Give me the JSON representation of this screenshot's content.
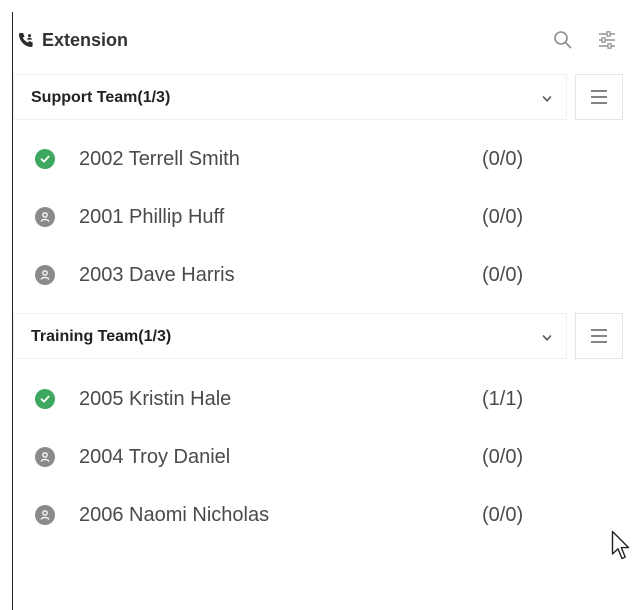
{
  "header": {
    "title": "Extension",
    "icons": [
      "phone-contacts-icon",
      "search-icon",
      "filter-sliders-icon"
    ]
  },
  "groups": [
    {
      "title": "Support Team(1/3)",
      "members": [
        {
          "name": "2002 Terrell Smith",
          "count": "(0/0)",
          "status": "online"
        },
        {
          "name": "2001 Phillip Huff",
          "count": "(0/0)",
          "status": "offline"
        },
        {
          "name": "2003 Dave Harris",
          "count": "(0/0)",
          "status": "offline"
        }
      ]
    },
    {
      "title": "Training Team(1/3)",
      "members": [
        {
          "name": "2005 Kristin Hale",
          "count": "(1/1)",
          "status": "online"
        },
        {
          "name": "2004 Troy Daniel",
          "count": "(0/0)",
          "status": "offline"
        },
        {
          "name": "2006 Naomi Nicholas",
          "count": "(0/0)",
          "status": "offline"
        }
      ]
    }
  ],
  "colors": {
    "online": "#3ea860",
    "offline": "#8a8a8a",
    "text": "#4a4a4a",
    "border": "#e6e6e6"
  }
}
